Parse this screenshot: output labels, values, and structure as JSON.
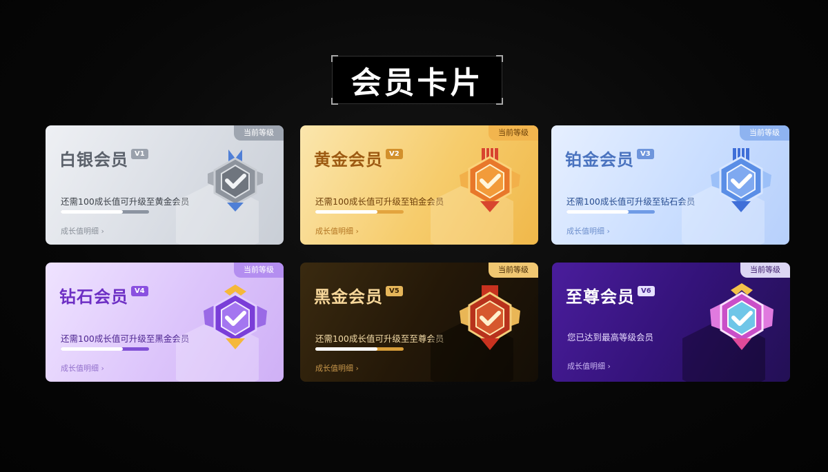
{
  "page": {
    "title": "会员卡片"
  },
  "cards": [
    {
      "name": "白银会员",
      "level": "V1",
      "tag": "当前等级",
      "hint": "还需100成长值可升级至黄金会员",
      "progress_percent": 70,
      "detail": "成长值明细 ›",
      "colors": {
        "accent": "#9aa1ac"
      },
      "icon": "silver-medal-icon"
    },
    {
      "name": "黄金会员",
      "level": "V2",
      "tag": "当前等级",
      "hint": "还需100成长值可升级至铂金会员",
      "progress_percent": 70,
      "detail": "成长值明细 ›",
      "colors": {
        "accent": "#d2902c"
      },
      "icon": "gold-medal-icon"
    },
    {
      "name": "铂金会员",
      "level": "V3",
      "tag": "当前等级",
      "hint": "还需100成长值可升级至钻石会员",
      "progress_percent": 70,
      "detail": "成长值明细 ›",
      "colors": {
        "accent": "#6e95dc"
      },
      "icon": "platinum-medal-icon"
    },
    {
      "name": "钻石会员",
      "level": "V4",
      "tag": "当前等级",
      "hint": "还需100成长值可升级至黑金会员",
      "progress_percent": 70,
      "detail": "成长值明细 ›",
      "colors": {
        "accent": "#8a50e0"
      },
      "icon": "diamond-medal-icon"
    },
    {
      "name": "黑金会员",
      "level": "V5",
      "tag": "当前等级",
      "hint": "还需100成长值可升级至至尊会员",
      "progress_percent": 70,
      "detail": "成长值明细 ›",
      "colors": {
        "accent": "#e6b65a"
      },
      "icon": "black-gold-medal-icon"
    },
    {
      "name": "至尊会员",
      "level": "V6",
      "tag": "当前等级",
      "hint": "您已达到最高等级会员",
      "detail": "成长值明细 ›",
      "colors": {
        "accent": "#e6e1ff"
      },
      "icon": "supreme-medal-icon"
    }
  ]
}
